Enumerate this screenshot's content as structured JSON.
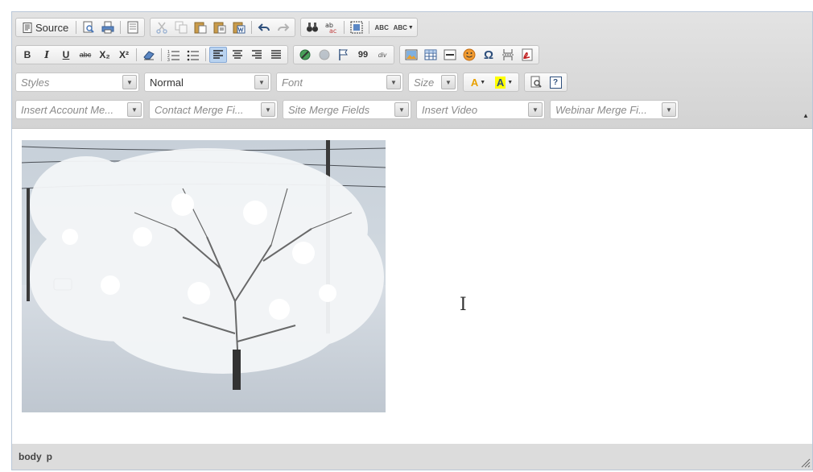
{
  "toolbar": {
    "source_label": "Source",
    "format_label": "B",
    "italic_label": "I",
    "underline_label": "U",
    "strike_label": "abc",
    "subscript_label": "X₂",
    "superscript_label": "X²",
    "quote_label": "99",
    "div_label": "div",
    "spell_label": "ABC",
    "scayt_label": "ABC",
    "font_color_label": "A",
    "bg_color_label": "A",
    "help_label": "?",
    "omega_label": "Ω"
  },
  "combos": {
    "styles": "Styles",
    "format": "Normal",
    "font": "Font",
    "size": "Size",
    "account_merge": "Insert Account Me...",
    "contact_merge": "Contact Merge Fi...",
    "site_merge": "Site Merge Fields",
    "insert_video": "Insert Video",
    "webinar_merge": "Webinar Merge Fi..."
  },
  "statusbar": {
    "path": [
      "body",
      "p"
    ]
  },
  "colors": {
    "accent": "#b9d3f0",
    "font_color": "#e8a000",
    "bg_color": "#ffff00"
  }
}
